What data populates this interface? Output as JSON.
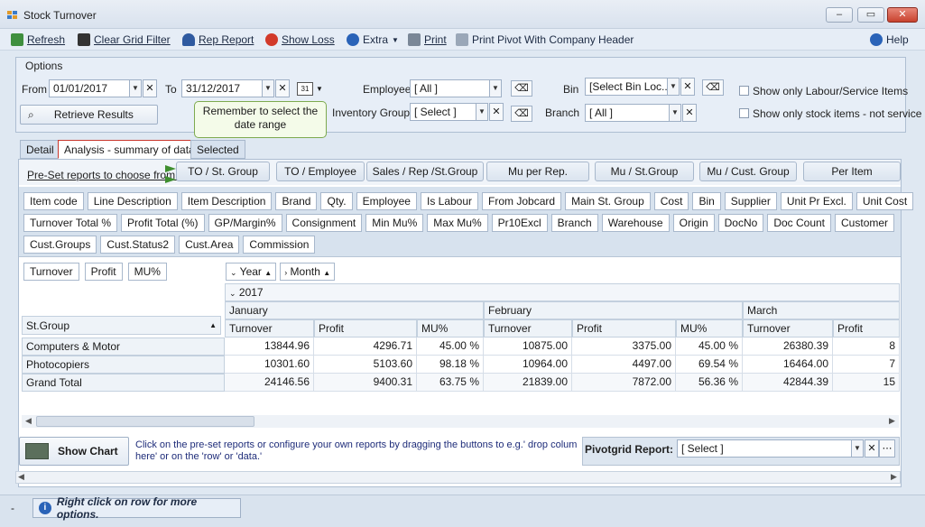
{
  "window": {
    "title": "Stock Turnover"
  },
  "toolbar": {
    "refresh": "Refresh",
    "clear_grid_filter": "Clear Grid Filter",
    "rep_report": "Rep Report",
    "show_loss": "Show Loss",
    "extra": "Extra",
    "print": "Print",
    "print_pivot": "Print Pivot With Company Header",
    "help": "Help"
  },
  "options": {
    "title": "Options",
    "from_label": "From",
    "from_value": "01/01/2017",
    "to_label": "To",
    "to_value": "31/12/2017",
    "calendar_icon_text": "31",
    "employee_label": "Employee",
    "employee_value": "[ All ]",
    "bin_label": "Bin",
    "bin_value": "[Select Bin Loc...",
    "inventory_group_label": "Inventory Group",
    "inventory_group_value": "[ Select ]",
    "branch_label": "Branch",
    "branch_value": "[ All ]",
    "retrieve_results": "Retrieve Results",
    "only_labour": "Show only Labour/Service Items",
    "only_stock": "Show only stock items - not service",
    "tooltip": "Remember to select the date range"
  },
  "tabs": [
    "Detail",
    "Analysis - summary of data",
    "Selected"
  ],
  "preset": {
    "label": "Pre-Set reports to choose from:",
    "buttons": [
      "TO / St. Group",
      "TO / Employee",
      "Sales / Rep /St.Group",
      "Mu per Rep.",
      "Mu / St.Group",
      "Mu / Cust. Group",
      "Per Item"
    ]
  },
  "field_buttons": {
    "row1": [
      "Item code",
      "Line Description",
      "Item Description",
      "Brand",
      "Qty.",
      "Employee",
      "Is Labour",
      "From Jobcard",
      "Main St. Group",
      "Cost",
      "Bin",
      "Supplier",
      "Unit Pr Excl.",
      "Unit Cost"
    ],
    "row2": [
      "Turnover Total %",
      "Profit Total (%)",
      "GP/Margin%",
      "Consignment",
      "Min Mu%",
      "Max Mu%",
      "Pr10Excl",
      "Branch",
      "Warehouse",
      "Origin",
      "DocNo",
      "Doc Count",
      "Customer"
    ],
    "row3": [
      "Cust.Groups",
      "Cust.Status2",
      "Cust.Area",
      "Commission"
    ]
  },
  "pivot": {
    "data_fields": [
      "Turnover",
      "Profit",
      "MU%"
    ],
    "column_fields": [
      "Year",
      "Month"
    ],
    "row_field": "St.Group",
    "year": "2017",
    "months": [
      "January",
      "February",
      "March"
    ],
    "measures": [
      "Turnover",
      "Profit",
      "MU%"
    ],
    "rows": [
      {
        "name": "Computers & Motor",
        "values": [
          "13844.96",
          "4296.71",
          "45.00 %",
          "10875.00",
          "3375.00",
          "45.00 %",
          "26380.39",
          "8"
        ]
      },
      {
        "name": "Photocopiers",
        "values": [
          "10301.60",
          "5103.60",
          "98.18 %",
          "10964.00",
          "4497.00",
          "69.54 %",
          "16464.00",
          "7"
        ]
      },
      {
        "name": "Grand Total",
        "values": [
          "24146.56",
          "9400.31",
          "63.75 %",
          "21839.00",
          "7872.00",
          "56.36 %",
          "42844.39",
          "15"
        ]
      }
    ]
  },
  "bottom": {
    "show_chart": "Show Chart",
    "hint": "Click on the pre-set reports  or configure your own reports by dragging the buttons to e.g.' drop colum here' or on the 'row' or 'data.'",
    "pivot_report_label": "Pivotgrid Report:",
    "pivot_report_value": "[ Select ]"
  },
  "status": {
    "dash": "-",
    "message": "Right click on row for more options."
  }
}
